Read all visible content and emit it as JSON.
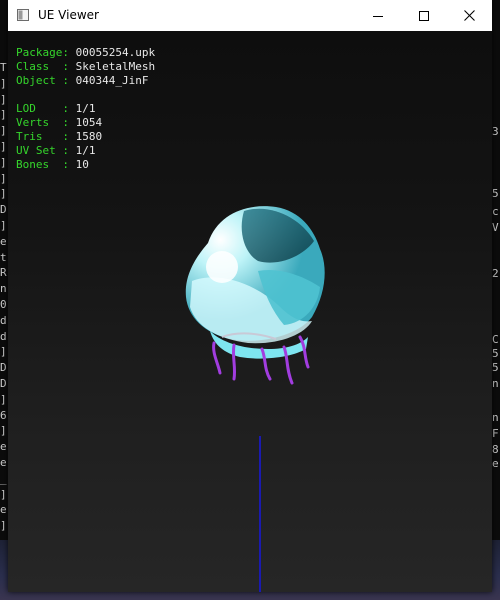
{
  "window": {
    "title": "UE Viewer"
  },
  "controls": {
    "minimize_icon": "minimize-icon",
    "maximize_icon": "maximize-icon",
    "close_icon": "close-icon"
  },
  "info": {
    "package": {
      "label": "Package:",
      "value": "00055254.upk"
    },
    "class": {
      "label": "Class  :",
      "value": "SkeletalMesh"
    },
    "object": {
      "label": "Object :",
      "value": "040344_JinF"
    },
    "lod": {
      "label": "LOD    :",
      "value": "1/1"
    },
    "verts": {
      "label": "Verts  :",
      "value": "1054"
    },
    "tris": {
      "label": "Tris   :",
      "value": "1580"
    },
    "uvset": {
      "label": "UV Set :",
      "value": "1/1"
    },
    "bones": {
      "label": "Bones  :",
      "value": "10"
    }
  },
  "colors": {
    "label": "#35d62c",
    "value": "#e8e8e8",
    "axis": "#1a1ab0",
    "mesh": "#5fd4e0",
    "bones": "#a23de0"
  },
  "background_console": {
    "left_chars": [
      "T",
      "]",
      "]",
      "]",
      "]",
      "]",
      "]",
      "]",
      "]",
      "D",
      "]",
      "e",
      "t",
      "R",
      "n",
      "0",
      "d",
      "d",
      "]",
      "D",
      "D",
      "]",
      "6",
      "]",
      "e",
      "e",
      "_",
      "]",
      "e",
      "]"
    ],
    "right_chars": [
      "3",
      "5",
      "c",
      "V",
      "2",
      "C",
      "5",
      "5",
      "n",
      "n",
      "F",
      "8",
      "e"
    ]
  }
}
